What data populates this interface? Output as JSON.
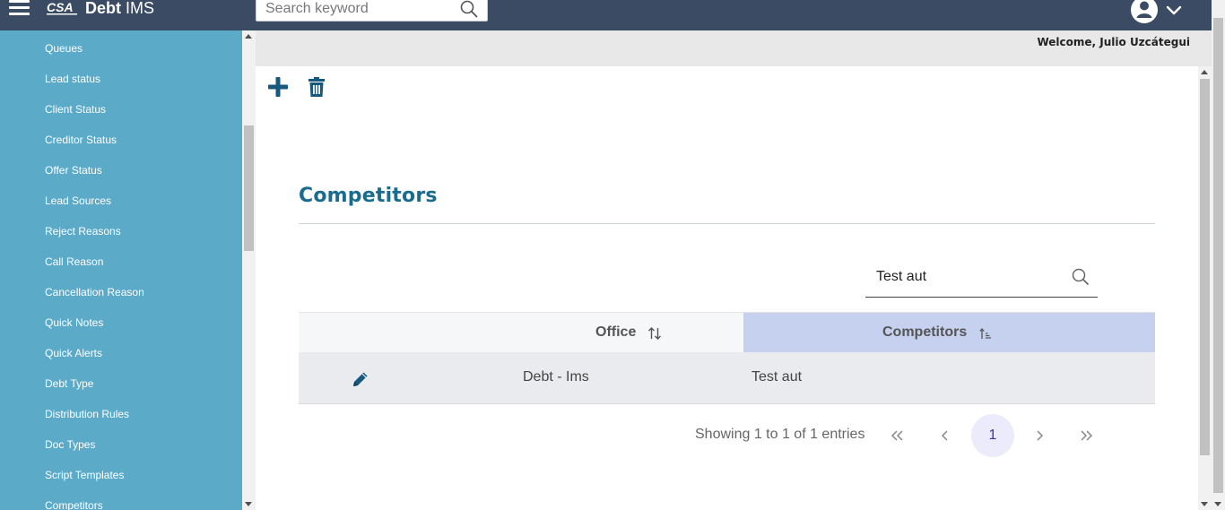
{
  "header": {
    "logo_mark": "CSA",
    "app_name_bold": "Debt",
    "app_name_rest": " IMS",
    "search_placeholder": "Search keyword"
  },
  "sidebar": {
    "items": [
      {
        "label": "Queues"
      },
      {
        "label": "Lead status"
      },
      {
        "label": "Client Status"
      },
      {
        "label": "Creditor Status"
      },
      {
        "label": "Offer Status"
      },
      {
        "label": "Lead Sources"
      },
      {
        "label": "Reject Reasons"
      },
      {
        "label": "Call Reason"
      },
      {
        "label": "Cancellation Reason"
      },
      {
        "label": "Quick Notes"
      },
      {
        "label": "Quick Alerts"
      },
      {
        "label": "Debt Type"
      },
      {
        "label": "Distribution Rules"
      },
      {
        "label": "Doc Types"
      },
      {
        "label": "Script Templates"
      },
      {
        "label": "Competitors"
      }
    ]
  },
  "welcome": "Welcome, Julio Uzcátegui",
  "page": {
    "title": "Competitors",
    "table_search_value": "Test aut"
  },
  "table": {
    "columns": [
      "Office",
      "Competitors"
    ],
    "sorted_column": "Competitors",
    "rows": [
      {
        "office": "Debt - Ims",
        "competitor": "Test aut"
      }
    ]
  },
  "pagination": {
    "info": "Showing 1 to 1 of 1 entries",
    "current_page": "1"
  },
  "colors": {
    "topbar": "#3b4b63",
    "sidebar": "#5aaac8",
    "title": "#1a6c8f",
    "sorted_header": "#c5d1ef",
    "icon_blue": "#17587e"
  }
}
